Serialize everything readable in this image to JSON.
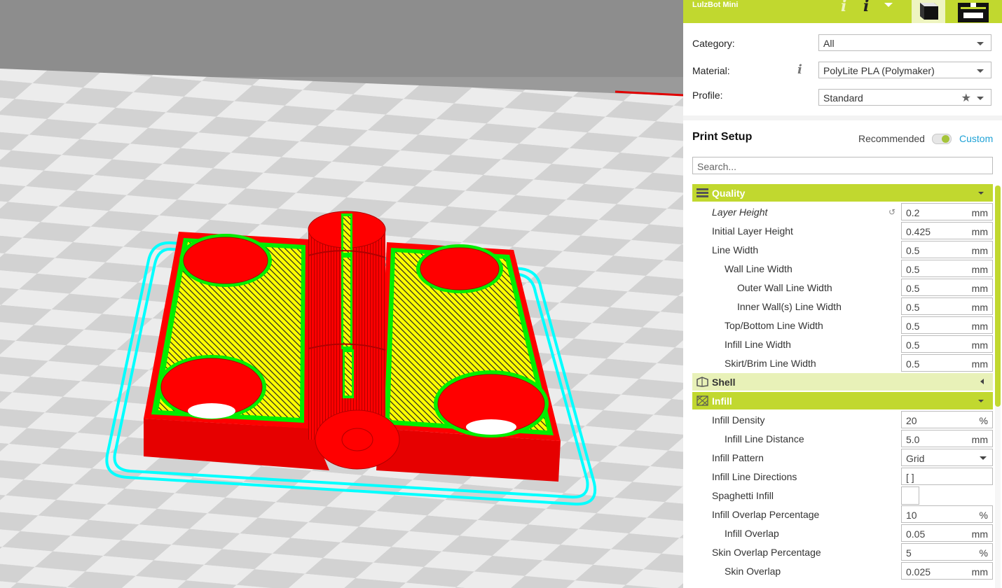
{
  "printer_name": "LulzBot Mini",
  "icons": {
    "info_light": "info-icon",
    "info_dark": "info-icon",
    "dropdown": "chevron-down-icon",
    "prepare_tab": "cube-icon",
    "monitor_tab": "printer-icon",
    "material_info": "info-icon",
    "favorite": "star-icon"
  },
  "labels": {
    "category": "Category:",
    "material": "Material:",
    "profile": "Profile:",
    "print_setup": "Print Setup",
    "recommended": "Recommended",
    "custom": "Custom"
  },
  "values": {
    "category": "All",
    "material": "PolyLite PLA (Polymaker)",
    "profile": "Standard"
  },
  "search": {
    "placeholder": "Search..."
  },
  "toggle": {
    "mode": "custom"
  },
  "colors": {
    "accent": "#c1d82f",
    "link": "#1fa2d6",
    "model_walls": "#ff0000",
    "model_infill": "#ffff00",
    "model_outline": "#00ff00",
    "skirt": "#00ffff"
  },
  "quality": {
    "name": "Quality",
    "icon": "layers-icon",
    "rows": [
      {
        "label": "Layer Height",
        "value": "0.2",
        "unit": "mm"
      },
      {
        "label": "Initial Layer Height",
        "value": "0.425",
        "unit": "mm"
      },
      {
        "label": "Line Width",
        "value": "0.5",
        "unit": "mm"
      },
      {
        "label": "Wall Line Width",
        "value": "0.5",
        "unit": "mm"
      },
      {
        "label": "Outer Wall Line Width",
        "value": "0.5",
        "unit": "mm"
      },
      {
        "label": "Inner Wall(s) Line Width",
        "value": "0.5",
        "unit": "mm"
      },
      {
        "label": "Top/Bottom Line Width",
        "value": "0.5",
        "unit": "mm"
      },
      {
        "label": "Infill Line Width",
        "value": "0.5",
        "unit": "mm"
      },
      {
        "label": "Skirt/Brim Line Width",
        "value": "0.5",
        "unit": "mm"
      }
    ]
  },
  "shell": {
    "name": "Shell",
    "icon": "shell-icon"
  },
  "infill": {
    "name": "Infill",
    "icon": "infill-icon",
    "rows": [
      {
        "label": "Infill Density",
        "value": "20",
        "unit": "%"
      },
      {
        "label": "Infill Line Distance",
        "value": "5.0",
        "unit": "mm"
      },
      {
        "label": "Infill Pattern",
        "value": "Grid",
        "unit": ""
      },
      {
        "label": "Infill Line Directions",
        "value": "[ ]",
        "unit": ""
      },
      {
        "label": "Spaghetti Infill",
        "value": "",
        "unit": ""
      },
      {
        "label": "Infill Overlap Percentage",
        "value": "10",
        "unit": "%"
      },
      {
        "label": "Infill Overlap",
        "value": "0.05",
        "unit": "mm"
      },
      {
        "label": "Skin Overlap Percentage",
        "value": "5",
        "unit": "%"
      },
      {
        "label": "Skin Overlap",
        "value": "0.025",
        "unit": "mm"
      }
    ]
  }
}
